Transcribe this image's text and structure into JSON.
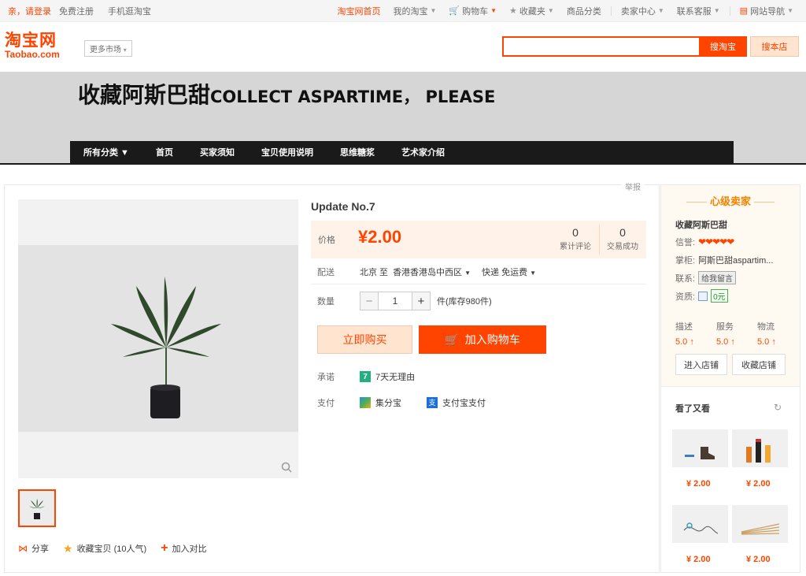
{
  "topbar": {
    "greeting": "亲，请登录",
    "register": "免费注册",
    "mobile": "手机逛淘宝",
    "home": "淘宝网首页",
    "my_taobao": "我的淘宝",
    "cart": "购物车",
    "favorites": "收藏夹",
    "categories": "商品分类",
    "seller_center": "卖家中心",
    "service": "联系客服",
    "site_nav": "网站导航"
  },
  "header": {
    "logo_cn": "淘宝网",
    "logo_en": "Taobao.com",
    "more_market": "更多市场",
    "search_placeholder": "",
    "search_button": "搜淘宝",
    "store_button": "搜本店"
  },
  "banner": {
    "title_cn": "收藏阿斯巴甜",
    "title_en": "COLLECT ASPARTIME， PLEASE",
    "nav": [
      "所有分类 ▼",
      "首页",
      "买家须知",
      "宝贝使用说明",
      "思维糖浆",
      "艺术家介绍"
    ]
  },
  "report": "举报",
  "product": {
    "title": "Update No.7",
    "price_label": "价格",
    "price": "¥2.00",
    "reviews_count": "0",
    "reviews_label": "累计评论",
    "sales_count": "0",
    "sales_label": "交易成功",
    "delivery_label": "配送",
    "delivery_from": "北京 至",
    "delivery_to": "香港香港岛中西区",
    "delivery_method": "快递 免运费",
    "qty_label": "数量",
    "qty_value": "1",
    "stock": "件(库存980件)",
    "buy_now": "立即购买",
    "add_cart": "加入购物车",
    "promise_label": "承诺",
    "promise": "7天无理由",
    "promise_badge": "7",
    "pay_label": "支付",
    "pay1": "集分宝",
    "pay2": "支付宝支付"
  },
  "actions": {
    "share": "分享",
    "favorite": "收藏宝贝 (10人气)",
    "compare": "加入对比"
  },
  "seller": {
    "level": "心级卖家",
    "name": "收藏阿斯巴甜",
    "credit_label": "信誉:",
    "credit_hearts": "❤❤❤❤❤",
    "owner_label": "掌柜:",
    "owner": "阿斯巴甜aspartim...",
    "contact_label": "联系:",
    "contact": "给我留言",
    "qual_label": "资质:",
    "qual_value": "0元",
    "scores": [
      {
        "label": "描述",
        "value": "5.0 ↑"
      },
      {
        "label": "服务",
        "value": "5.0 ↑"
      },
      {
        "label": "物流",
        "value": "5.0 ↑"
      }
    ],
    "enter_shop": "进入店铺",
    "fav_shop": "收藏店铺"
  },
  "seen": {
    "title": "看了又看",
    "items": [
      {
        "price": "¥ 2.00"
      },
      {
        "price": "¥ 2.00"
      },
      {
        "price": "¥ 2.00"
      },
      {
        "price": "¥ 2.00"
      }
    ]
  },
  "colors": {
    "accent": "#ff4400",
    "banner": "#d6d6d6",
    "nav": "#1a1a1a"
  }
}
